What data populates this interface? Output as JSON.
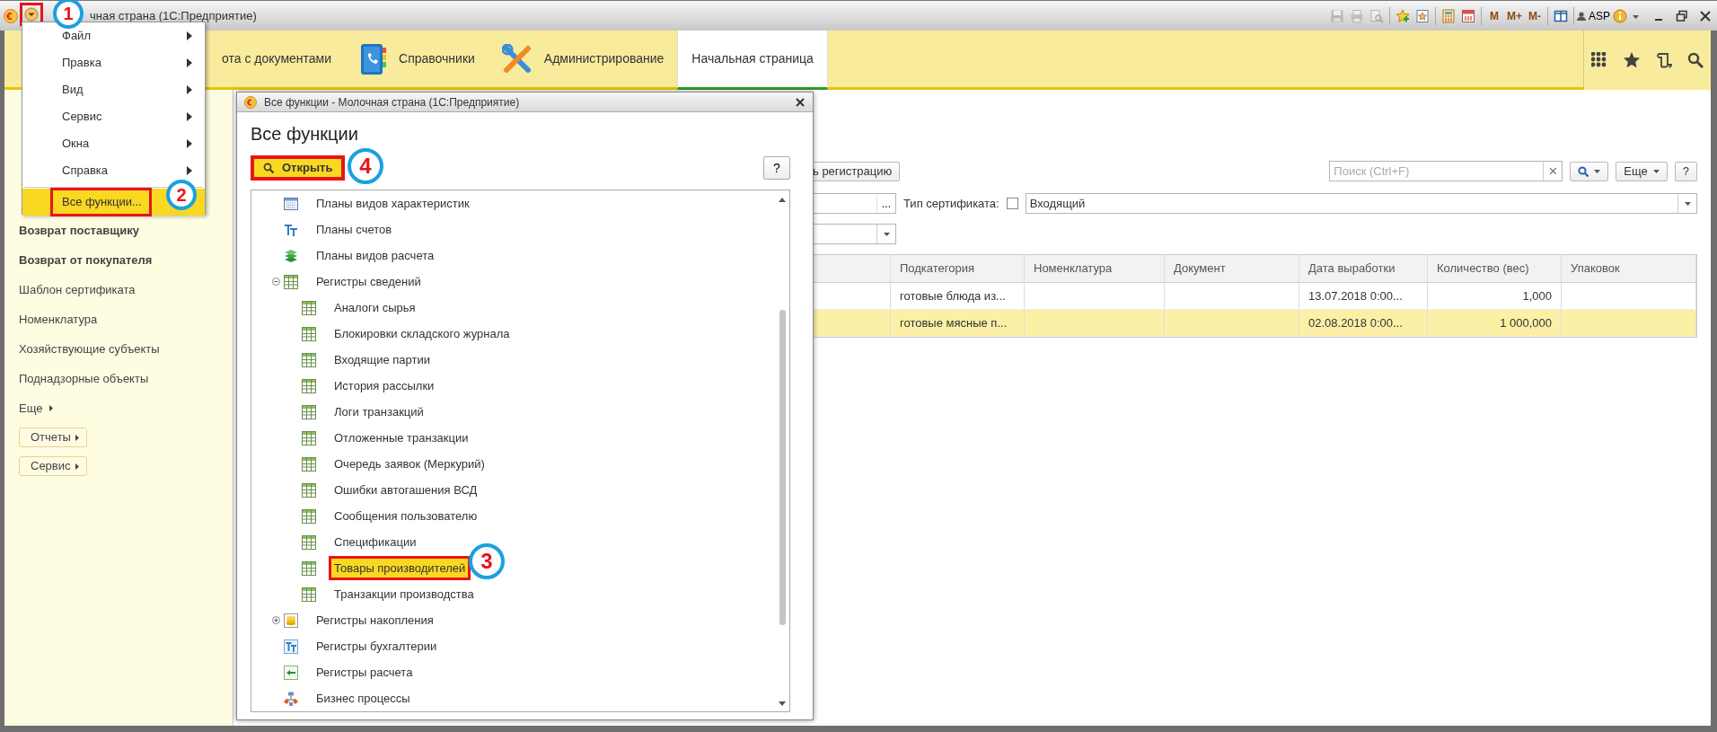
{
  "title_bar": {
    "menu_button": {
      "marked": true
    },
    "title": "чная страна  (1С:Предприятие)",
    "toolbar": [
      {
        "kind": "save",
        "disabled": true
      },
      {
        "kind": "print",
        "disabled": true
      },
      {
        "kind": "preview",
        "disabled": true
      },
      {
        "kind": "separator"
      },
      {
        "kind": "fav-add",
        "disabled": false
      },
      {
        "kind": "fav",
        "disabled": false
      },
      {
        "kind": "separator"
      },
      {
        "kind": "calc",
        "disabled": false
      },
      {
        "kind": "calendar",
        "disabled": false
      },
      {
        "kind": "separator"
      },
      {
        "kind": "memory",
        "label": "M",
        "disabled": false
      },
      {
        "kind": "memory",
        "label": "M+",
        "disabled": false
      },
      {
        "kind": "memory",
        "label": "M-",
        "disabled": false
      },
      {
        "kind": "separator"
      },
      {
        "kind": "panel",
        "disabled": false
      },
      {
        "kind": "separator"
      },
      {
        "kind": "user",
        "label": "ASP",
        "disabled": false
      },
      {
        "kind": "info",
        "disabled": false
      }
    ]
  },
  "sections": [
    {
      "label": "ота с документами",
      "kind": "cut",
      "selected": false
    },
    {
      "label": "Справочники",
      "kind": "catalogs",
      "selected": false
    },
    {
      "label": "Администрирование",
      "kind": "admin",
      "selected": false
    },
    {
      "label": "Начальная страница",
      "kind": "home",
      "selected": true
    }
  ],
  "sidebar": [
    {
      "label": "Возврат поставщику",
      "kind": "bold"
    },
    {
      "label": "Возврат от покупателя",
      "kind": "bold"
    },
    {
      "label": "Шаблон сертификата",
      "kind": "plain"
    },
    {
      "label": "Номенклатура",
      "kind": "plain"
    },
    {
      "label": "Хозяйствующие субъекты",
      "kind": "plain"
    },
    {
      "label": "Поднадзорные объекты",
      "kind": "plain"
    },
    {
      "label": "Еще",
      "kind": "more"
    },
    {
      "label": "Отчеты",
      "kind": "button"
    },
    {
      "label": "Сервис",
      "kind": "button"
    }
  ],
  "content": {
    "register_button": "ь регистрацию",
    "search": {
      "placeholder": "Поиск (Ctrl+F)"
    },
    "more_button": "Еще",
    "help_button": "?",
    "select_button": "...",
    "certificate_type": {
      "label": "Тип сертификата:",
      "checked": false,
      "value": "Входящий"
    },
    "table": {
      "columns": [
        "Подкатегория",
        "Номенклатура",
        "Документ",
        "Дата выработки",
        "Количество (вес)",
        "Упаковок"
      ],
      "rows": [
        {
          "subcategory": "готовые блюда из...",
          "production_date": "13.07.2018 0:00...",
          "quantity": "1,000",
          "selected": false
        },
        {
          "subcategory": "готовые мясные п...",
          "production_date": "02.08.2018 0:00...",
          "quantity": "1 000,000",
          "selected": true
        }
      ]
    }
  },
  "main_menu": [
    {
      "label": "Файл",
      "kind": "submenu",
      "selected": false,
      "marked": false
    },
    {
      "label": "Правка",
      "kind": "submenu",
      "selected": false,
      "marked": false
    },
    {
      "label": "Вид",
      "kind": "submenu",
      "selected": false,
      "marked": false
    },
    {
      "label": "Сервис",
      "kind": "submenu",
      "selected": false,
      "marked": false
    },
    {
      "label": "Окна",
      "kind": "submenu",
      "selected": false,
      "marked": false
    },
    {
      "label": "Справка",
      "kind": "submenu",
      "selected": false,
      "marked": false
    },
    {
      "kind": "separator"
    },
    {
      "label": "Все функции...",
      "kind": "command",
      "selected": true,
      "marked": true
    }
  ],
  "dialog": {
    "title": "Все функции - Молочная страна  (1С:Предприятие)",
    "heading": "Все функции",
    "open_button": {
      "label": "Открыть",
      "marked": true
    },
    "help_button": "?",
    "tree": [
      {
        "label": "Планы видов характеристик",
        "kind": "char-types",
        "selected": false,
        "marked": false
      },
      {
        "label": "Планы счетов",
        "kind": "accounts",
        "selected": false,
        "marked": false
      },
      {
        "label": "Планы видов расчета",
        "kind": "calc-types",
        "selected": false,
        "marked": false
      },
      {
        "label": "Регистры сведений",
        "kind": "register",
        "selected": false,
        "marked": false,
        "expanded": true,
        "children": [
          {
            "label": "Аналоги сырья",
            "kind": "register",
            "selected": false,
            "marked": false
          },
          {
            "label": "Блокировки складского журнала",
            "kind": "register",
            "selected": false,
            "marked": false
          },
          {
            "label": "Входящие партии",
            "kind": "register",
            "selected": false,
            "marked": false
          },
          {
            "label": "История рассылки",
            "kind": "register",
            "selected": false,
            "marked": false
          },
          {
            "label": "Логи транзакций",
            "kind": "register",
            "selected": false,
            "marked": false
          },
          {
            "label": "Отложенные транзакции",
            "kind": "register",
            "selected": false,
            "marked": false
          },
          {
            "label": "Очередь заявок (Меркурий)",
            "kind": "register",
            "selected": false,
            "marked": false
          },
          {
            "label": "Ошибки автогашения ВСД",
            "kind": "register",
            "selected": false,
            "marked": false
          },
          {
            "label": "Сообщения пользователю",
            "kind": "register",
            "selected": false,
            "marked": false
          },
          {
            "label": "Спецификации",
            "kind": "register",
            "selected": false,
            "marked": false
          },
          {
            "label": "Товары производителей",
            "kind": "register",
            "selected": true,
            "marked": true
          },
          {
            "label": "Транзакции производства",
            "kind": "register",
            "selected": false,
            "marked": false
          }
        ]
      },
      {
        "label": "Регистры накопления",
        "kind": "accum",
        "selected": false,
        "marked": false,
        "expanded": false
      },
      {
        "label": "Регистры бухгалтерии",
        "kind": "acc-register",
        "selected": false,
        "marked": false
      },
      {
        "label": "Регистры расчета",
        "kind": "calc-register",
        "selected": false,
        "marked": false
      },
      {
        "label": "Бизнес процессы",
        "kind": "process",
        "selected": false,
        "marked": false
      }
    ]
  },
  "annotations": [
    {
      "label": "1"
    },
    {
      "label": "2"
    },
    {
      "label": "3"
    },
    {
      "label": "4"
    }
  ]
}
